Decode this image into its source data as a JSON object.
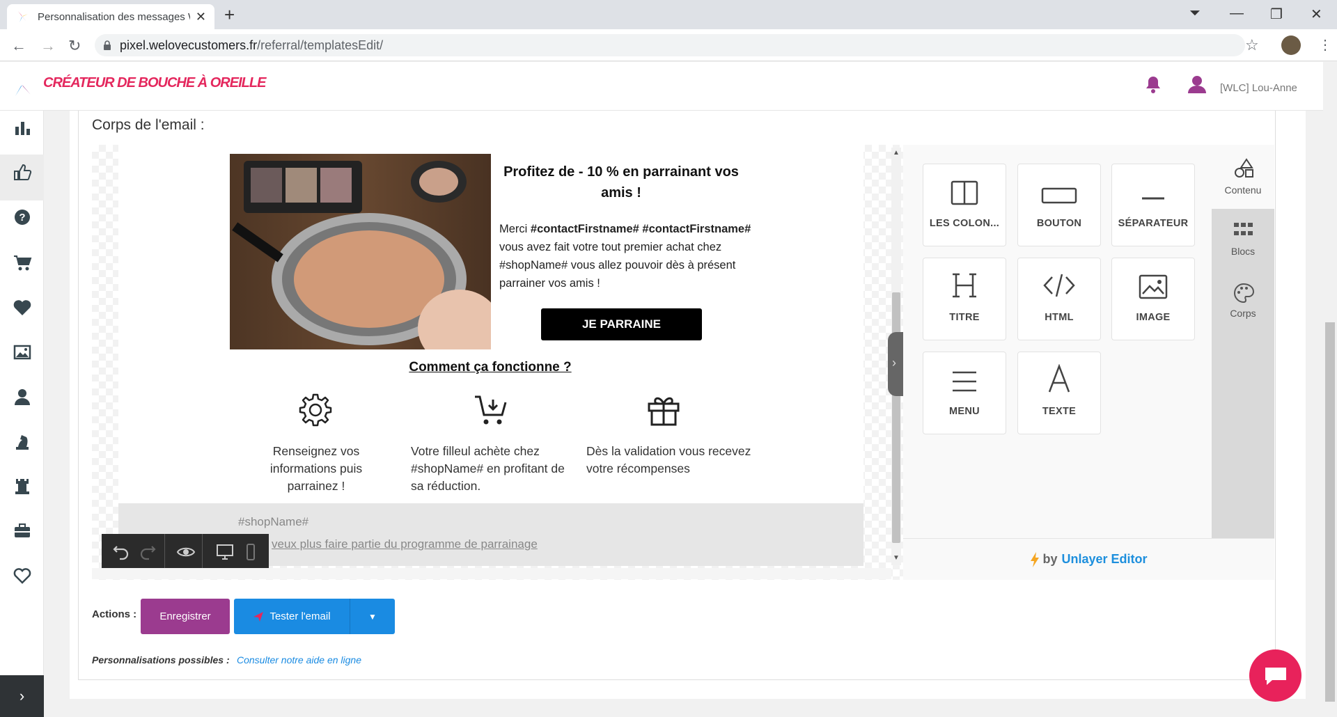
{
  "browser": {
    "tab_title": "Personnalisation des messages W",
    "url_host": "pixel.welovecustomers.fr",
    "url_path": "/referral/templatesEdit/"
  },
  "app": {
    "logo_text": "CRÉATEUR DE BOUCHE À OREILLE",
    "user_name": "[WLC] Lou-Anne"
  },
  "sidebar": [
    "chart-icon",
    "thumbs-up-icon",
    "help-icon",
    "cart-icon",
    "heart-icon",
    "image-icon",
    "user-icon",
    "chess-knight-icon",
    "rook-icon",
    "briefcase-icon",
    "heart-outline-icon"
  ],
  "editor": {
    "section_label": "Corps de l'email :",
    "headline": "Profitez de - 10 % en parrainant vos amis !",
    "body_prefix": "Merci ",
    "body_bold": "#contactFirstname# #contactFirstname#",
    "body_rest": " vous avez fait votre tout premier achat chez #shopName# vous allez pouvoir dès à présent parrainer vos amis !",
    "cta": "JE PARRAINE",
    "how_title": "Comment ça fonctionne ?",
    "steps": [
      "Renseignez vos informations puis parrainez !",
      "Votre filleul achète chez #shopName# en profitant de sa réduction.",
      "Dès la validation vous recevez votre récompenses"
    ],
    "footer_shop": "#shopName#",
    "footer_unsub": "veux plus faire partie du programme de parrainage"
  },
  "tools": [
    "LES COLON...",
    "BOUTON",
    "SÉPARATEUR",
    "TITRE",
    "HTML",
    "IMAGE",
    "MENU",
    "TEXTE"
  ],
  "tool_tabs": [
    "Contenu",
    "Blocs",
    "Corps"
  ],
  "unlayer": {
    "by": "by",
    "editor": "Unlayer Editor"
  },
  "actions": {
    "label": "Actions :",
    "save": "Enregistrer",
    "test": "Tester l'email",
    "perso_label": "Personnalisations possibles :",
    "perso_link": "Consulter notre aide en ligne"
  },
  "colors": {
    "brand": "#e4275d",
    "save": "#9b3b8f",
    "primary": "#1a8be2"
  }
}
